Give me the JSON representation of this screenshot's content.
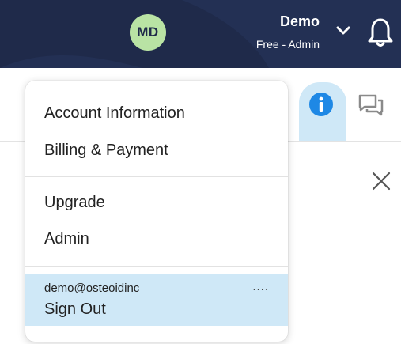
{
  "header": {
    "avatar_initials": "MD",
    "user_name": "Demo",
    "user_role": "Free - Admin",
    "icons": {
      "dropdown": "chevron-down-icon",
      "notifications": "bell-icon"
    },
    "colors": {
      "background": "#1f2a4a",
      "avatar": "#b9e3a4"
    }
  },
  "toolbar": {
    "icons": {
      "info": "info-icon",
      "chat": "chat-icon",
      "close": "close-icon"
    },
    "colors": {
      "info_accent": "#1e88e5",
      "active_tab": "#cfe8f7"
    }
  },
  "dropdown": {
    "items": [
      {
        "label": "Account Information"
      },
      {
        "label": "Billing & Payment"
      },
      {
        "label": "Upgrade"
      },
      {
        "label": "Admin"
      }
    ],
    "account": {
      "email": "demo@osteoidinc",
      "more": "....",
      "sign_out": "Sign Out"
    }
  }
}
